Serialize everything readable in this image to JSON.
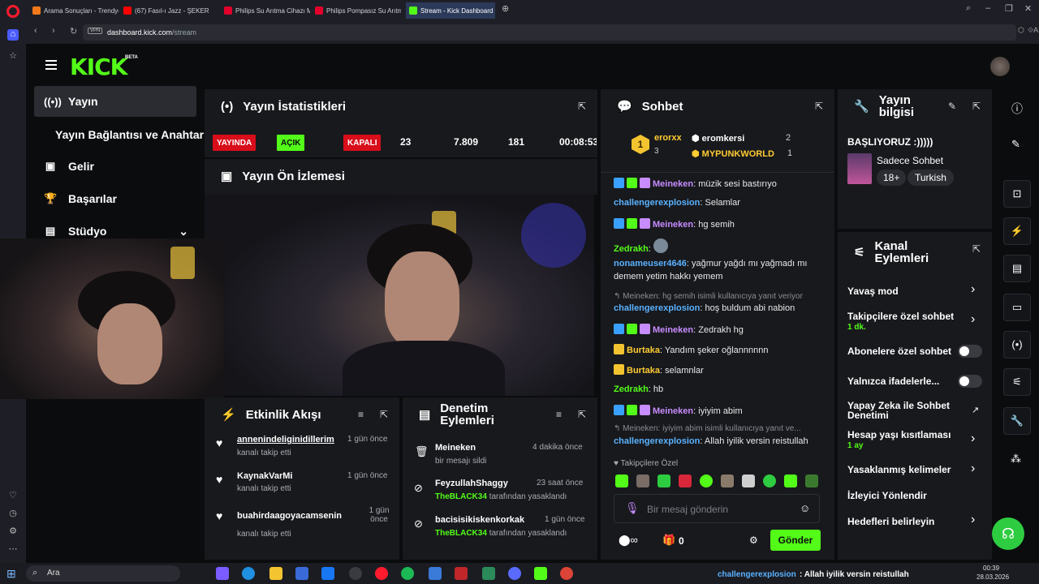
{
  "browser": {
    "tabs": [
      {
        "label": "Arama Sonuçları - Trendyol",
        "color": "#f27a1a"
      },
      {
        "label": "(67) Fasıl-ı Jazz - ŞEKER",
        "color": "#ff0000"
      },
      {
        "label": "Philips Su Arıtma Cihazı M",
        "color": "#e4002b"
      },
      {
        "label": "Philips Pompasız Su Arıtm",
        "color": "#e4002b"
      },
      {
        "label": "Stream - Kick Dashboard",
        "color": "#53fc18"
      }
    ],
    "vpn": "VPN",
    "url_domain": "dashboard.kick.com",
    "url_path": "/stream",
    "ai_label": "AI"
  },
  "app": {
    "logo": "KICK",
    "beta": "BETA"
  },
  "nav": {
    "items": [
      {
        "label": "Yayın",
        "icon": "broadcast-icon"
      },
      {
        "label": "Yayın Bağlantısı ve Anahtarı"
      },
      {
        "label": "Gelir",
        "icon": "wallet-icon"
      },
      {
        "label": "Başarılar",
        "icon": "trophy-icon"
      },
      {
        "label": "Stüdyo",
        "icon": "studio-icon"
      }
    ]
  },
  "stats": {
    "title": "Yayın İstatistikleri",
    "live": "YAYINDA",
    "open": "AÇIK",
    "closed": "KAPALI",
    "value1": "23",
    "value2": "7.809",
    "value3": "181",
    "duration": "00:08:53"
  },
  "preview": {
    "title": "Yayın Ön İzlemesi"
  },
  "activity": {
    "title": "Etkinlik Akışı",
    "items": [
      {
        "user": "annenindeliginidillerim",
        "action": "kanalı takip etti",
        "time": "1 gün önce"
      },
      {
        "user": "KaynakVarMi",
        "action": "kanalı takip etti",
        "time": "1 gün önce"
      },
      {
        "user": "buahirdaagoyacamsenin",
        "action": "kanalı takip etti",
        "time": "1 gün önce"
      }
    ]
  },
  "moderation": {
    "title": "Denetim Eylemleri",
    "items": [
      {
        "user": "Meineken",
        "action": "bir mesajı sildi",
        "time": "4 dakika önce"
      },
      {
        "user": "FeyzullahShaggy",
        "by": "TheBLACK34",
        "action": "tarafından yasaklandı",
        "time": "23 saat önce"
      },
      {
        "user": "bacisisikiskenkorkak",
        "by": "TheBLACK34",
        "action": "tarafından yasaklandı",
        "time": "1 gün önce"
      }
    ]
  },
  "chat": {
    "title": "Sohbet",
    "top": [
      {
        "rank": "1",
        "name": "erorxx",
        "count": "3"
      },
      {
        "name": "eromkersi",
        "count": "2"
      },
      {
        "name": "MYPUNKWORLD",
        "count": "1"
      }
    ],
    "messages": [
      {
        "user": "Meineken",
        "text": "müzik sesi bastırıyo"
      },
      {
        "user": "challengerexplosion",
        "text": "Selamlar"
      },
      {
        "user": "Meineken",
        "text": "hg semih"
      },
      {
        "user": "Zedrakh",
        "text": ""
      },
      {
        "user": "nonameuser4646",
        "text": "yağmur yağdı mı yağmadı mı"
      },
      {
        "user": "",
        "text": "demem yetim hakkı yemem"
      },
      {
        "reply": "Meineken: hg semih isimli kullanıcıya yanıt veriyor"
      },
      {
        "user": "challengerexplosion",
        "text": "hoş buldum abi nabion"
      },
      {
        "user": "Meineken",
        "text": "Zedrakh hg"
      },
      {
        "user": "Burtaka",
        "text": "Yandım şeker oğlannnnnn"
      },
      {
        "user": "Burtaka",
        "text": "selamnlar"
      },
      {
        "user": "Zedrakh",
        "text": "hb"
      },
      {
        "user": "Meineken",
        "text": "iyiyim abim"
      },
      {
        "reply": "Meineken: iyiyim abim isimli kullanıcıya yanıt ve..."
      },
      {
        "user": "challengerexplosion",
        "text": "Allah iyilik versin reistullah"
      }
    ],
    "follower_label": "Takipçilere Özel",
    "placeholder": "Bir mesaj gönderin",
    "gift_count": "0",
    "send": "Gönder"
  },
  "info": {
    "title": "Yayın bilgisi",
    "stream_title": "BAŞLIYORUZ :)))))",
    "category": "Sadece Sohbet",
    "tags": [
      "18+",
      "Turkish"
    ]
  },
  "channel": {
    "title": "Kanal Eylemleri",
    "items": [
      {
        "label": "Yavaş mod"
      },
      {
        "label": "Takipçilere özel sohbet",
        "sub": "1 dk."
      },
      {
        "label": "Abonelere özel sohbet"
      },
      {
        "label": "Yalnızca ifadelerle..."
      },
      {
        "label": "Yapay Zeka ile Sohbet Denetimi"
      },
      {
        "label": "Hesap yaşı kısıtlaması",
        "sub": "1 ay"
      },
      {
        "label": "Yasaklanmış kelimeler"
      },
      {
        "label": "İzleyici Yönlendir"
      },
      {
        "label": "Hedefleri belirleyin"
      }
    ]
  },
  "taskbar": {
    "search": "Ara",
    "ticker_user": "challengerexplosion",
    "ticker_text": ": Allah iyilik versin reistullah",
    "time": "00:39",
    "date": "28.03.2026"
  }
}
